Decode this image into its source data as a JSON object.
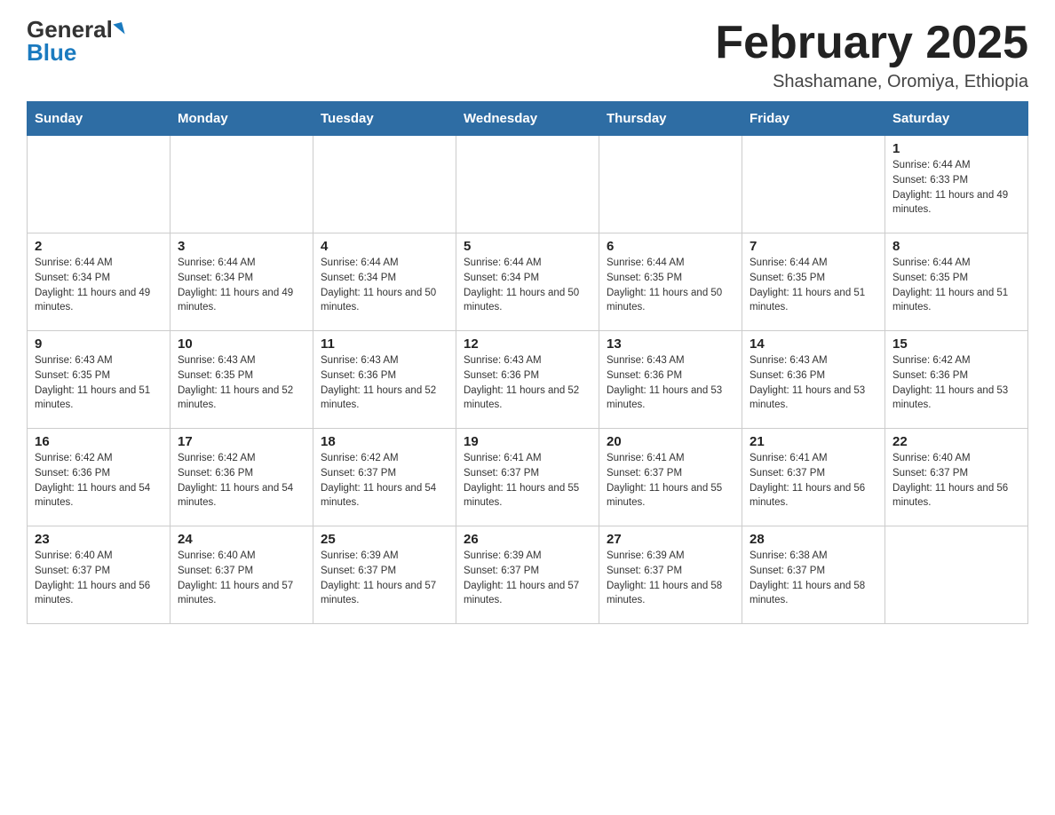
{
  "logo": {
    "general": "General",
    "blue": "Blue"
  },
  "title": "February 2025",
  "location": "Shashamane, Oromiya, Ethiopia",
  "days_of_week": [
    "Sunday",
    "Monday",
    "Tuesday",
    "Wednesday",
    "Thursday",
    "Friday",
    "Saturday"
  ],
  "weeks": [
    [
      {
        "day": "",
        "sunrise": "",
        "sunset": "",
        "daylight": ""
      },
      {
        "day": "",
        "sunrise": "",
        "sunset": "",
        "daylight": ""
      },
      {
        "day": "",
        "sunrise": "",
        "sunset": "",
        "daylight": ""
      },
      {
        "day": "",
        "sunrise": "",
        "sunset": "",
        "daylight": ""
      },
      {
        "day": "",
        "sunrise": "",
        "sunset": "",
        "daylight": ""
      },
      {
        "day": "",
        "sunrise": "",
        "sunset": "",
        "daylight": ""
      },
      {
        "day": "1",
        "sunrise": "Sunrise: 6:44 AM",
        "sunset": "Sunset: 6:33 PM",
        "daylight": "Daylight: 11 hours and 49 minutes."
      }
    ],
    [
      {
        "day": "2",
        "sunrise": "Sunrise: 6:44 AM",
        "sunset": "Sunset: 6:34 PM",
        "daylight": "Daylight: 11 hours and 49 minutes."
      },
      {
        "day": "3",
        "sunrise": "Sunrise: 6:44 AM",
        "sunset": "Sunset: 6:34 PM",
        "daylight": "Daylight: 11 hours and 49 minutes."
      },
      {
        "day": "4",
        "sunrise": "Sunrise: 6:44 AM",
        "sunset": "Sunset: 6:34 PM",
        "daylight": "Daylight: 11 hours and 50 minutes."
      },
      {
        "day": "5",
        "sunrise": "Sunrise: 6:44 AM",
        "sunset": "Sunset: 6:34 PM",
        "daylight": "Daylight: 11 hours and 50 minutes."
      },
      {
        "day": "6",
        "sunrise": "Sunrise: 6:44 AM",
        "sunset": "Sunset: 6:35 PM",
        "daylight": "Daylight: 11 hours and 50 minutes."
      },
      {
        "day": "7",
        "sunrise": "Sunrise: 6:44 AM",
        "sunset": "Sunset: 6:35 PM",
        "daylight": "Daylight: 11 hours and 51 minutes."
      },
      {
        "day": "8",
        "sunrise": "Sunrise: 6:44 AM",
        "sunset": "Sunset: 6:35 PM",
        "daylight": "Daylight: 11 hours and 51 minutes."
      }
    ],
    [
      {
        "day": "9",
        "sunrise": "Sunrise: 6:43 AM",
        "sunset": "Sunset: 6:35 PM",
        "daylight": "Daylight: 11 hours and 51 minutes."
      },
      {
        "day": "10",
        "sunrise": "Sunrise: 6:43 AM",
        "sunset": "Sunset: 6:35 PM",
        "daylight": "Daylight: 11 hours and 52 minutes."
      },
      {
        "day": "11",
        "sunrise": "Sunrise: 6:43 AM",
        "sunset": "Sunset: 6:36 PM",
        "daylight": "Daylight: 11 hours and 52 minutes."
      },
      {
        "day": "12",
        "sunrise": "Sunrise: 6:43 AM",
        "sunset": "Sunset: 6:36 PM",
        "daylight": "Daylight: 11 hours and 52 minutes."
      },
      {
        "day": "13",
        "sunrise": "Sunrise: 6:43 AM",
        "sunset": "Sunset: 6:36 PM",
        "daylight": "Daylight: 11 hours and 53 minutes."
      },
      {
        "day": "14",
        "sunrise": "Sunrise: 6:43 AM",
        "sunset": "Sunset: 6:36 PM",
        "daylight": "Daylight: 11 hours and 53 minutes."
      },
      {
        "day": "15",
        "sunrise": "Sunrise: 6:42 AM",
        "sunset": "Sunset: 6:36 PM",
        "daylight": "Daylight: 11 hours and 53 minutes."
      }
    ],
    [
      {
        "day": "16",
        "sunrise": "Sunrise: 6:42 AM",
        "sunset": "Sunset: 6:36 PM",
        "daylight": "Daylight: 11 hours and 54 minutes."
      },
      {
        "day": "17",
        "sunrise": "Sunrise: 6:42 AM",
        "sunset": "Sunset: 6:36 PM",
        "daylight": "Daylight: 11 hours and 54 minutes."
      },
      {
        "day": "18",
        "sunrise": "Sunrise: 6:42 AM",
        "sunset": "Sunset: 6:37 PM",
        "daylight": "Daylight: 11 hours and 54 minutes."
      },
      {
        "day": "19",
        "sunrise": "Sunrise: 6:41 AM",
        "sunset": "Sunset: 6:37 PM",
        "daylight": "Daylight: 11 hours and 55 minutes."
      },
      {
        "day": "20",
        "sunrise": "Sunrise: 6:41 AM",
        "sunset": "Sunset: 6:37 PM",
        "daylight": "Daylight: 11 hours and 55 minutes."
      },
      {
        "day": "21",
        "sunrise": "Sunrise: 6:41 AM",
        "sunset": "Sunset: 6:37 PM",
        "daylight": "Daylight: 11 hours and 56 minutes."
      },
      {
        "day": "22",
        "sunrise": "Sunrise: 6:40 AM",
        "sunset": "Sunset: 6:37 PM",
        "daylight": "Daylight: 11 hours and 56 minutes."
      }
    ],
    [
      {
        "day": "23",
        "sunrise": "Sunrise: 6:40 AM",
        "sunset": "Sunset: 6:37 PM",
        "daylight": "Daylight: 11 hours and 56 minutes."
      },
      {
        "day": "24",
        "sunrise": "Sunrise: 6:40 AM",
        "sunset": "Sunset: 6:37 PM",
        "daylight": "Daylight: 11 hours and 57 minutes."
      },
      {
        "day": "25",
        "sunrise": "Sunrise: 6:39 AM",
        "sunset": "Sunset: 6:37 PM",
        "daylight": "Daylight: 11 hours and 57 minutes."
      },
      {
        "day": "26",
        "sunrise": "Sunrise: 6:39 AM",
        "sunset": "Sunset: 6:37 PM",
        "daylight": "Daylight: 11 hours and 57 minutes."
      },
      {
        "day": "27",
        "sunrise": "Sunrise: 6:39 AM",
        "sunset": "Sunset: 6:37 PM",
        "daylight": "Daylight: 11 hours and 58 minutes."
      },
      {
        "day": "28",
        "sunrise": "Sunrise: 6:38 AM",
        "sunset": "Sunset: 6:37 PM",
        "daylight": "Daylight: 11 hours and 58 minutes."
      },
      {
        "day": "",
        "sunrise": "",
        "sunset": "",
        "daylight": ""
      }
    ]
  ]
}
